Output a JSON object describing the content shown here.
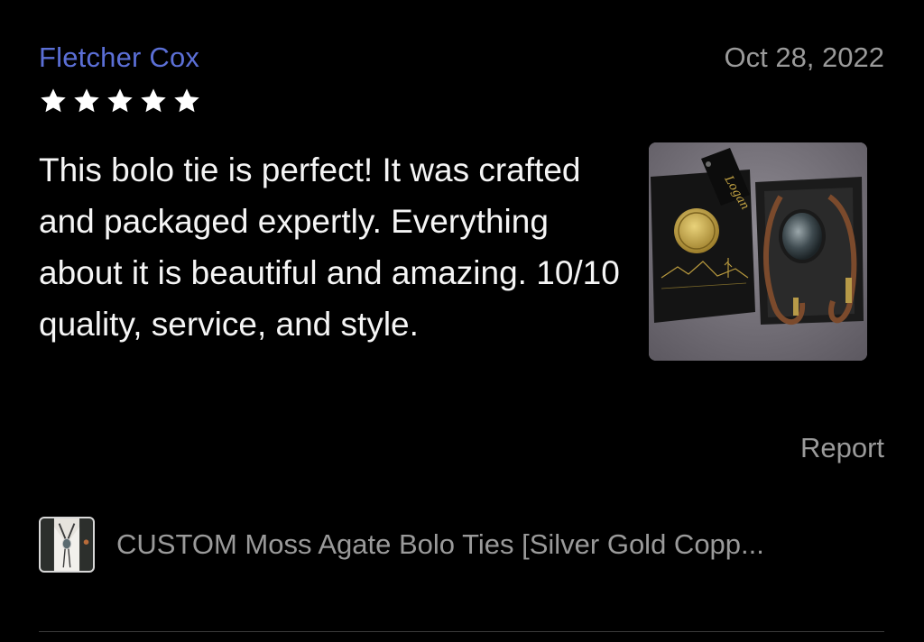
{
  "review": {
    "reviewer_name": "Fletcher Cox",
    "date": "Oct 28, 2022",
    "rating": 5,
    "rating_max": 5,
    "text": "This bolo tie is perfect! It was crafted and packaged expertly. Everything about it is beautiful and amazing. 10/10 quality, service, and style.",
    "photo_icon": "review-photo",
    "report_label": "Report"
  },
  "product": {
    "title": "CUSTOM Moss Agate Bolo Ties [Silver Gold Copp...",
    "thumb_icon": "product-thumbnail"
  },
  "colors": {
    "background": "#000000",
    "reviewer_name": "#5b6fd6",
    "muted_text": "#9a9a9a",
    "body_text": "#f5f5f5",
    "star": "#ffffff"
  }
}
